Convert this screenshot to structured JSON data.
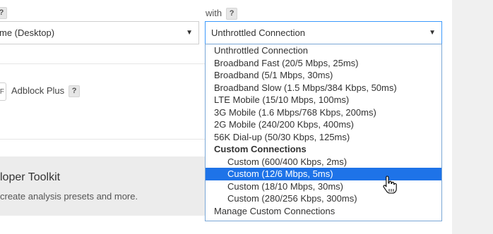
{
  "browser_select": {
    "value": "me (Desktop)"
  },
  "connection": {
    "label": "with",
    "value": "Unthrottled Connection",
    "options": [
      {
        "label": "Unthrottled Connection",
        "kind": "option"
      },
      {
        "label": "Broadband Fast (20/5 Mbps, 25ms)",
        "kind": "option"
      },
      {
        "label": "Broadband (5/1 Mbps, 30ms)",
        "kind": "option"
      },
      {
        "label": "Broadband Slow (1.5 Mbps/384 Kbps, 50ms)",
        "kind": "option"
      },
      {
        "label": "LTE Mobile (15/10 Mbps, 100ms)",
        "kind": "option"
      },
      {
        "label": "3G Mobile (1.6 Mbps/768 Kbps, 200ms)",
        "kind": "option"
      },
      {
        "label": "2G Mobile (240/200 Kbps, 400ms)",
        "kind": "option"
      },
      {
        "label": "56K Dial-up (50/30 Kbps, 125ms)",
        "kind": "option"
      },
      {
        "label": "Custom Connections",
        "kind": "group"
      },
      {
        "label": "Custom (600/400 Kbps, 2ms)",
        "kind": "indent"
      },
      {
        "label": "Custom (12/6 Mbps, 5ms)",
        "kind": "indent",
        "selected": true
      },
      {
        "label": "Custom (18/10 Mbps, 30ms)",
        "kind": "indent"
      },
      {
        "label": "Custom (280/256 Kbps, 300ms)",
        "kind": "indent"
      },
      {
        "label": "Manage Custom Connections",
        "kind": "option"
      }
    ]
  },
  "help_mark": "?",
  "adblock": {
    "toggle_text": "F",
    "label": "Adblock Plus"
  },
  "dev_toolkit": {
    "title": "loper Toolkit",
    "text": "create analysis presets and more."
  },
  "colors": {
    "highlight": "#1e73e8",
    "focus_border": "#3b99fc"
  }
}
